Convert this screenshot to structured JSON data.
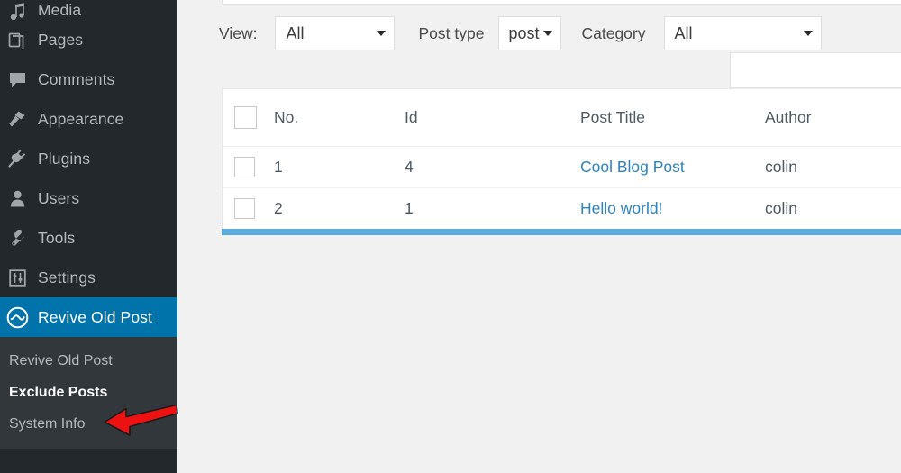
{
  "sidebar": {
    "bg_color": "#23282d",
    "submenu_bg_color": "#32373c",
    "active_color": "#0073aa",
    "items": [
      {
        "label": "Media",
        "icon": "media-icon",
        "partial": true,
        "current": false
      },
      {
        "label": "Pages",
        "icon": "pages-icon",
        "partial": false,
        "current": false
      },
      {
        "label": "Comments",
        "icon": "comments-icon",
        "partial": false,
        "current": false
      },
      {
        "label": "Appearance",
        "icon": "appearance-icon",
        "partial": false,
        "current": false
      },
      {
        "label": "Plugins",
        "icon": "plugins-icon",
        "partial": false,
        "current": false
      },
      {
        "label": "Users",
        "icon": "users-icon",
        "partial": false,
        "current": false
      },
      {
        "label": "Tools",
        "icon": "tools-icon",
        "partial": false,
        "current": false
      },
      {
        "label": "Settings",
        "icon": "settings-icon",
        "partial": false,
        "current": false
      },
      {
        "label": "Revive Old Post",
        "icon": "revive-old-post-icon",
        "partial": false,
        "current": true
      }
    ],
    "submenu": [
      {
        "label": "Revive Old Post",
        "active": false
      },
      {
        "label": "Exclude Posts",
        "active": true
      },
      {
        "label": "System Info",
        "active": false
      }
    ]
  },
  "filters": {
    "view_label": "View:",
    "view_value": "All",
    "post_type_label": "Post type",
    "post_type_value": "post",
    "category_label": "Category",
    "category_value": "All",
    "search_value": "",
    "search_placeholder": ""
  },
  "table": {
    "columns": [
      "",
      "No.",
      "Id",
      "Post Title",
      "Author"
    ],
    "rows": [
      {
        "no": "1",
        "id": "4",
        "title": "Cool Blog Post",
        "author": "colin",
        "checked": false
      },
      {
        "no": "2",
        "id": "1",
        "title": "Hello world!",
        "author": "colin",
        "checked": false
      }
    ],
    "link_color": "#2f82c0",
    "accent_bar_color": "#5aabdd"
  },
  "annotation": {
    "arrow_color": "#ee1111",
    "points_to": "Exclude Posts"
  }
}
